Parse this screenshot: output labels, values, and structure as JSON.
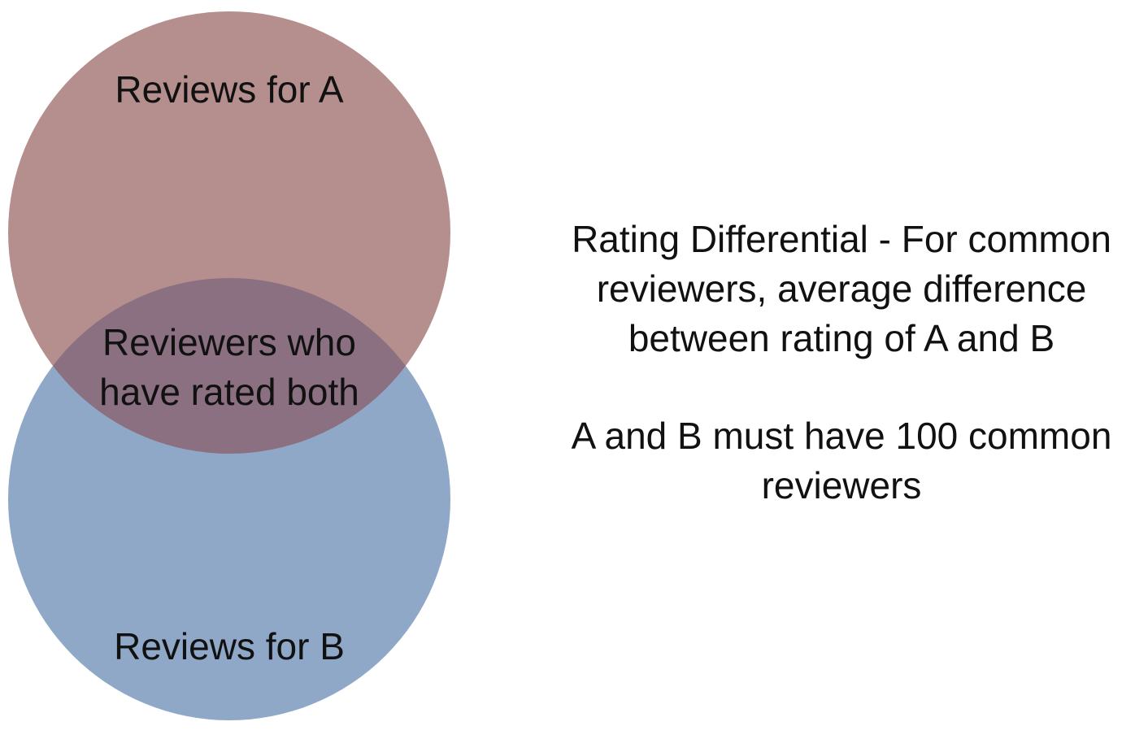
{
  "diagram": {
    "circle_a": {
      "label": "Reviews for A",
      "color": "#B58E8E"
    },
    "circle_b": {
      "label": "Reviews for B",
      "color": "#8FA8C8"
    },
    "overlap": {
      "label_line1": "Reviewers who",
      "label_line2": "have rated both",
      "color": "#8A7080"
    }
  },
  "text": {
    "definition_lines": [
      "Rating Differential - For common",
      "reviewers, average difference",
      "between rating of A and B"
    ],
    "requirement_lines": [
      "A and B must have 100 common",
      "reviewers"
    ]
  }
}
